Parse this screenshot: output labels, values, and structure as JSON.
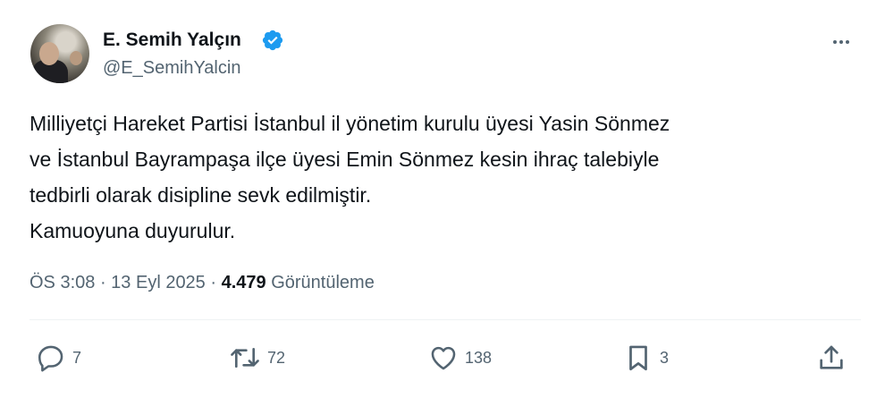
{
  "user": {
    "display_name": "E. Semih Yalçın",
    "handle": "@E_SemihYalcin",
    "avatar_icon": "profile-photo",
    "verified_icon": "verified-badge-icon"
  },
  "tweet": {
    "lines": [
      "Milliyetçi Hareket Partisi İstanbul il yönetim kurulu üyesi Yasin Sönmez",
      "ve İstanbul Bayrampaşa ilçe üyesi Emin Sönmez kesin ihraç talebiyle",
      "tedbirli olarak disipline sevk edilmiştir.",
      "Kamuoyuna duyurulur."
    ]
  },
  "meta": {
    "time": "ÖS 3:08",
    "separator1": " · ",
    "date": "13 Eyl 2025",
    "separator2": " · ",
    "views_count": "4.479",
    "views_label": " Görüntüleme"
  },
  "actions": {
    "reply_count": "7",
    "retweet_count": "72",
    "like_count": "138",
    "bookmark_count": "3"
  },
  "colors": {
    "text_primary": "#0f1419",
    "text_secondary": "#536471",
    "verified_blue": "#1d9bf0",
    "divider": "#eff3f4"
  }
}
